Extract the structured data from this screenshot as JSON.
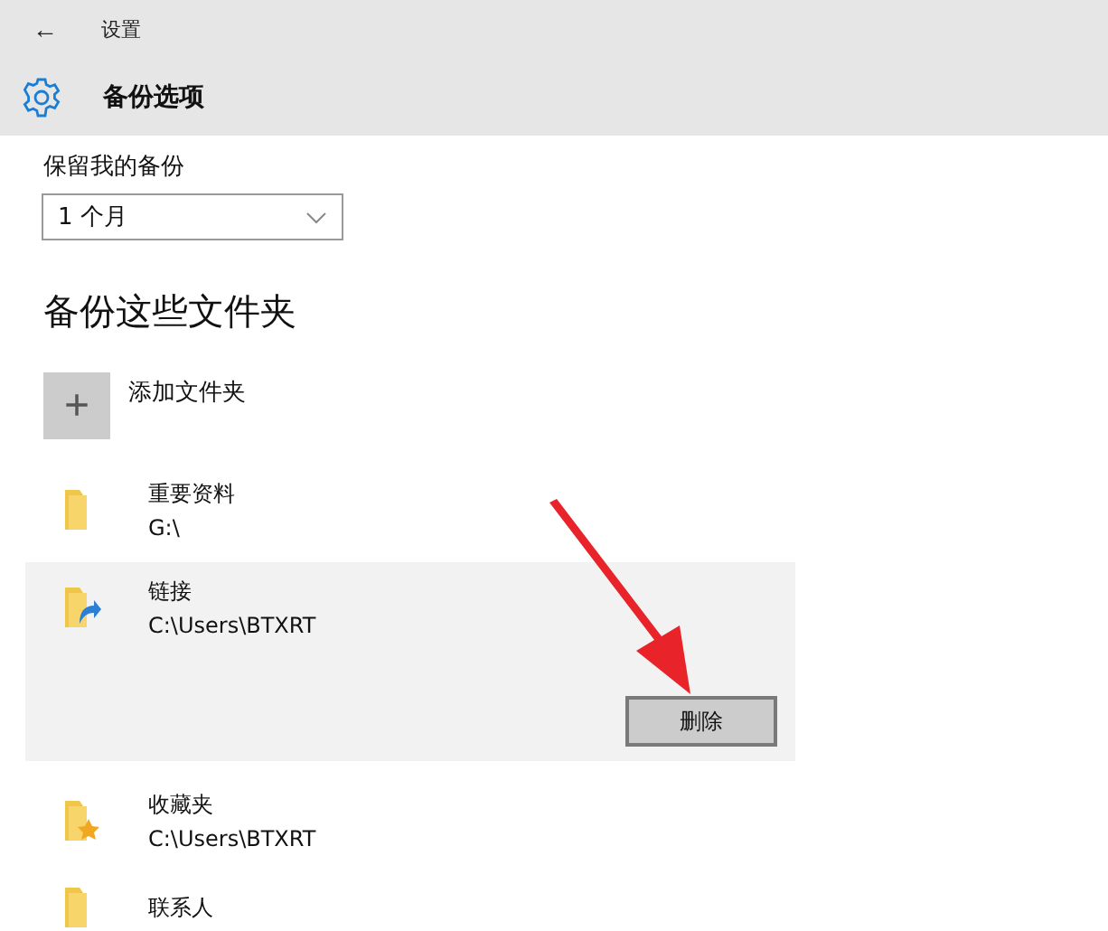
{
  "header": {
    "back": "←",
    "app_title": "设置",
    "page_title": "备份选项"
  },
  "retention": {
    "label": "保留我的备份",
    "value": "1 个月"
  },
  "section_title": "备份这些文件夹",
  "add_button": {
    "icon": "+",
    "label": "添加文件夹"
  },
  "folders": [
    {
      "name": "重要资料",
      "path": "G:\\",
      "kind": "plain",
      "selected": false
    },
    {
      "name": "链接",
      "path": "C:\\Users\\BTXRT",
      "kind": "link",
      "selected": true,
      "action": "删除"
    },
    {
      "name": "收藏夹",
      "path": "C:\\Users\\BTXRT",
      "kind": "favorites",
      "selected": false
    },
    {
      "name": "联系人",
      "kind": "plain",
      "selected": false
    }
  ]
}
